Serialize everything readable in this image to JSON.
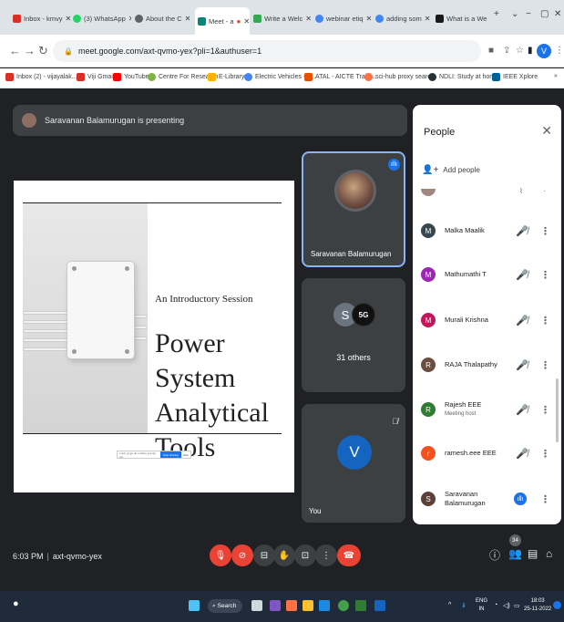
{
  "browser": {
    "tabs": [
      {
        "label": "Inbox - kmvy",
        "color": "#d93025"
      },
      {
        "label": "(3) WhatsApp",
        "color": "#25d366"
      },
      {
        "label": "About the C",
        "color": "#5f6368"
      },
      {
        "label": "Meet - a",
        "color": "#00897b"
      },
      {
        "label": "Write a Welc",
        "color": "#34a853"
      },
      {
        "label": "webinar etiq",
        "color": "#4285f4"
      },
      {
        "label": "adding som",
        "color": "#4285f4"
      },
      {
        "label": "What is a We",
        "color": "#1a1a1a"
      }
    ],
    "new_tab": "+",
    "url": "meet.google.com/axt-qvmo-yex?pli=1&authuser=1",
    "profile_initial": "V",
    "bookmarks": [
      {
        "label": "Inbox (2) - vijayalak...",
        "color": "#d93025"
      },
      {
        "label": "Viji Gmail",
        "color": "#d93025"
      },
      {
        "label": "YouTube",
        "color": "#ff0000"
      },
      {
        "label": "Centre For Research",
        "color": "#7cb342"
      },
      {
        "label": "E-Library",
        "color": "#ffb300"
      },
      {
        "label": "Electric Vehicles - P...",
        "color": "#4285f4"
      },
      {
        "label": "ATAL - AICTE Traini...",
        "color": "#e65100"
      },
      {
        "label": "sci-hub proxy searc...",
        "color": "#ff7043"
      },
      {
        "label": "NDLI: Study at home",
        "color": "#263238"
      },
      {
        "label": "IEEE Xplore",
        "color": "#00629b"
      }
    ]
  },
  "meet": {
    "presenting_text": "Saravanan Balamurugan is presenting",
    "slide": {
      "subtitle": "An Introductory Session",
      "title": "Power System Analytical Tools",
      "share_text": "I rerrr gr ge un o shere g to lpr vor",
      "share_button": "Stop sharing",
      "hide_button": "Hide"
    },
    "tiles": {
      "presenter_name": "Saravanan Balamurugan",
      "group_initial": "S",
      "group_logo": "5G",
      "others_label": "31 others",
      "self_initial": "V",
      "self_label": "You"
    },
    "people": {
      "title": "People",
      "add_label": "Add people",
      "participants": [
        {
          "name": "Malka Maalik",
          "initial": "M",
          "color": "#37474f",
          "role": ""
        },
        {
          "name": "Mathumathi T",
          "initial": "M",
          "color": "#9c27b0",
          "role": ""
        },
        {
          "name": "Murali Krishna",
          "initial": "M",
          "color": "#c2185b",
          "role": ""
        },
        {
          "name": "RAJA Thalapathy",
          "initial": "R",
          "color": "#6d4c41",
          "role": ""
        },
        {
          "name": "Rajesh EEE",
          "initial": "R",
          "color": "#2e7d32",
          "role": "Meeting host"
        },
        {
          "name": "ramesh.eee EEE",
          "initial": "r",
          "color": "#f4511e",
          "role": ""
        },
        {
          "name": "Saravanan Balamurugan",
          "initial": "S",
          "color": "#5d4037",
          "role": ""
        }
      ]
    },
    "control_bar": {
      "time": "6:03 PM",
      "meeting_code": "axt-qvmo-yex",
      "participant_count": "34"
    }
  },
  "taskbar": {
    "search_label": "Search",
    "lang_line1": "ENG",
    "lang_line2": "IN",
    "time": "18:03",
    "date": "25-11-2022"
  }
}
